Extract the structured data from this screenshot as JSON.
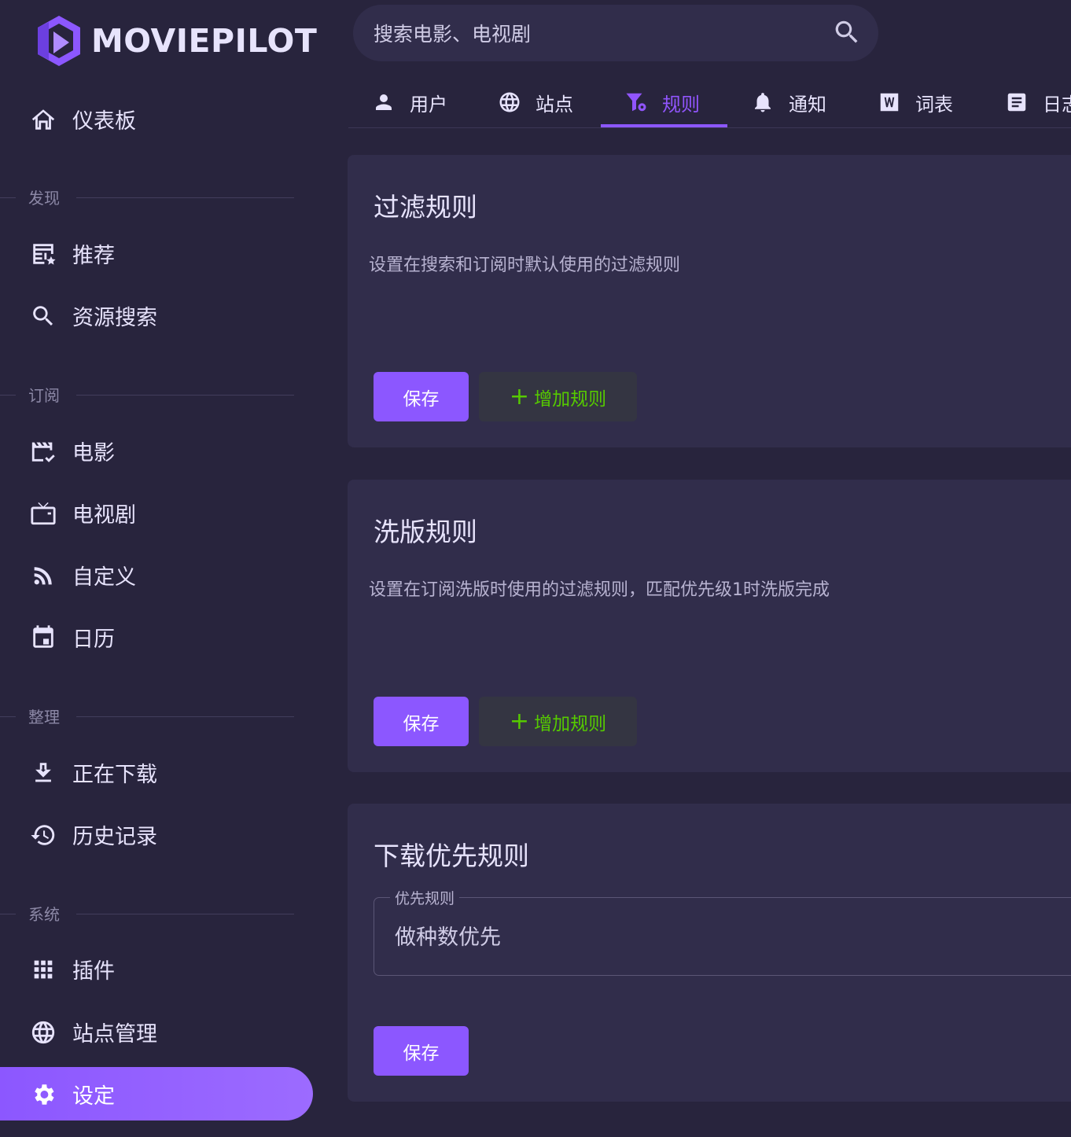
{
  "app": {
    "logo_text": "MOVIEPILOT"
  },
  "search": {
    "placeholder": "搜索电影、电视剧"
  },
  "sidebar": {
    "dashboard": "仪表板",
    "sections": [
      "发现",
      "订阅",
      "整理",
      "系统"
    ],
    "discover": [
      "推荐",
      "资源搜索"
    ],
    "subscribe": [
      "电影",
      "电视剧",
      "自定义",
      "日历"
    ],
    "organize": [
      "正在下载",
      "历史记录"
    ],
    "system": [
      "插件",
      "站点管理",
      "设定"
    ]
  },
  "tabs": [
    "用户",
    "站点",
    "规则",
    "通知",
    "词表",
    "日志"
  ],
  "active_tab": "规则",
  "cards": {
    "filter": {
      "title": "过滤规则",
      "description": "设置在搜索和订阅时默认使用的过滤规则",
      "save": "保存",
      "add": "增加规则"
    },
    "upgrade": {
      "title": "洗版规则",
      "description": "设置在订阅洗版时使用的过滤规则，匹配优先级1时洗版完成",
      "save": "保存",
      "add": "增加规则"
    },
    "priority": {
      "title": "下载优先规则",
      "field_label": "优先规则",
      "field_value": "做种数优先",
      "save": "保存"
    }
  },
  "colors": {
    "accent": "#8c57ff",
    "success": "#56ca00",
    "background": "#28243d",
    "surface": "#312d4b"
  }
}
